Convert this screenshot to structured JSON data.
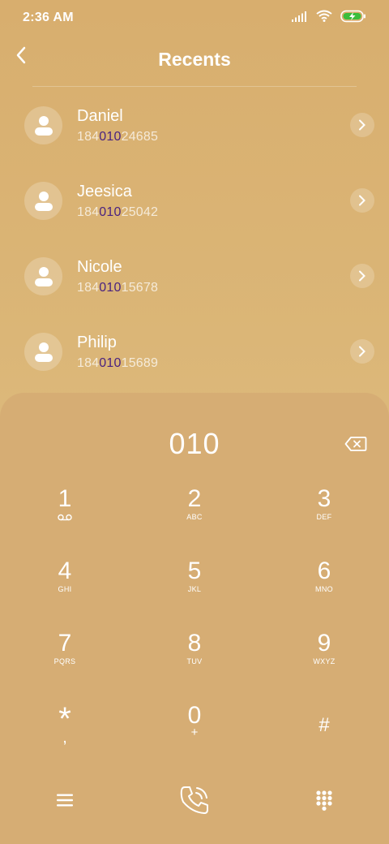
{
  "status_bar": {
    "time": "2:36 AM",
    "icons": [
      "signal-icon",
      "wifi-icon",
      "battery-charging-icon"
    ]
  },
  "header": {
    "title": "Recents",
    "back_icon": "chevron-left-icon"
  },
  "recents": [
    {
      "name": "Daniel",
      "number_prefix": "184",
      "number_match": "010",
      "number_suffix": "24685"
    },
    {
      "name": "Jeesica",
      "number_prefix": "184",
      "number_match": "010",
      "number_suffix": "25042"
    },
    {
      "name": "Nicole",
      "number_prefix": "184",
      "number_match": "010",
      "number_suffix": "15678"
    },
    {
      "name": "Philip",
      "number_prefix": "184",
      "number_match": "010",
      "number_suffix": "15689"
    }
  ],
  "dialpad": {
    "entered": "010",
    "keys": [
      {
        "digit": "1",
        "sub": ""
      },
      {
        "digit": "2",
        "sub": "ABC"
      },
      {
        "digit": "3",
        "sub": "DEF"
      },
      {
        "digit": "4",
        "sub": "GHI"
      },
      {
        "digit": "5",
        "sub": "JKL"
      },
      {
        "digit": "6",
        "sub": "MNO"
      },
      {
        "digit": "7",
        "sub": "PQRS"
      },
      {
        "digit": "8",
        "sub": "TUV"
      },
      {
        "digit": "9",
        "sub": "WXYZ"
      },
      {
        "digit": "*",
        "sub": ","
      },
      {
        "digit": "0",
        "sub": "+"
      },
      {
        "digit": "#",
        "sub": ""
      }
    ]
  },
  "bottom_bar": {
    "icons": [
      "menu-icon",
      "call-icon",
      "dialpad-icon"
    ]
  },
  "colors": {
    "background": "#dbb677",
    "dialpad": "#d6ad74",
    "match_highlight": "#4a2380"
  }
}
